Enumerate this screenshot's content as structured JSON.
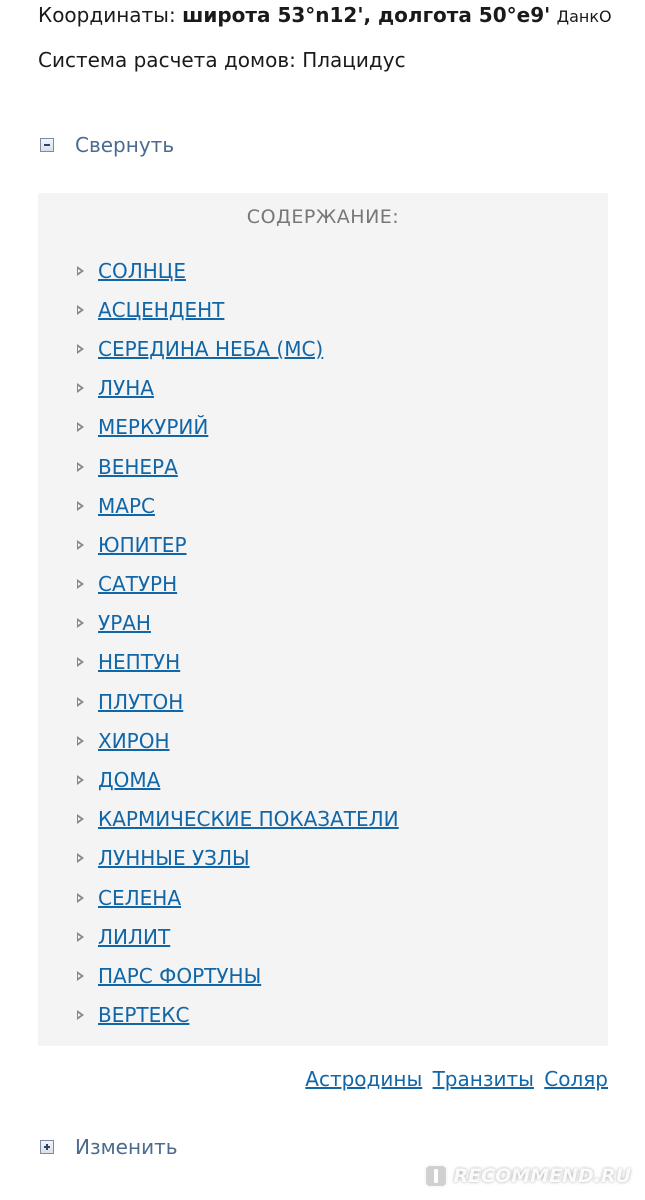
{
  "header": {
    "coords_label": "Координаты:",
    "coords_value": "широта 53°n12', долгота 50°e9'",
    "coords_suffix": "ДанкО",
    "houses": "Система расчета домов: Плацидус"
  },
  "collapse": {
    "label": "Свернуть"
  },
  "toc": {
    "title": "СОДЕРЖАНИЕ:",
    "items": [
      "СОЛНЦЕ",
      "АСЦЕНДЕНТ",
      "СЕРЕДИНА НЕБА (MC)",
      "ЛУНА",
      "МЕРКУРИЙ",
      "ВЕНЕРА",
      "МАРС",
      "ЮПИТЕР",
      "САТУРН",
      "УРАН",
      "НЕПТУН",
      "ПЛУТОН",
      "ХИРОН",
      "ДОМА",
      "КАРМИЧЕСКИЕ ПОКАЗАТЕЛИ",
      "ЛУННЫЕ УЗЛЫ",
      "СЕЛЕНА",
      "ЛИЛИТ",
      "ПАРС ФОРТУНЫ",
      "ВЕРТЕКС"
    ]
  },
  "bottom_links": {
    "astrodyne": "Астродины",
    "transits": "Транзиты",
    "solar": "Соляр"
  },
  "expand": {
    "label": "Изменить"
  },
  "watermark": {
    "text": "RECOMMEND.RU"
  },
  "colors": {
    "link": "#1166a8",
    "toggle_label": "#4b6b8f",
    "toc_background": "#f4f4f4",
    "toc_title": "#777777"
  }
}
